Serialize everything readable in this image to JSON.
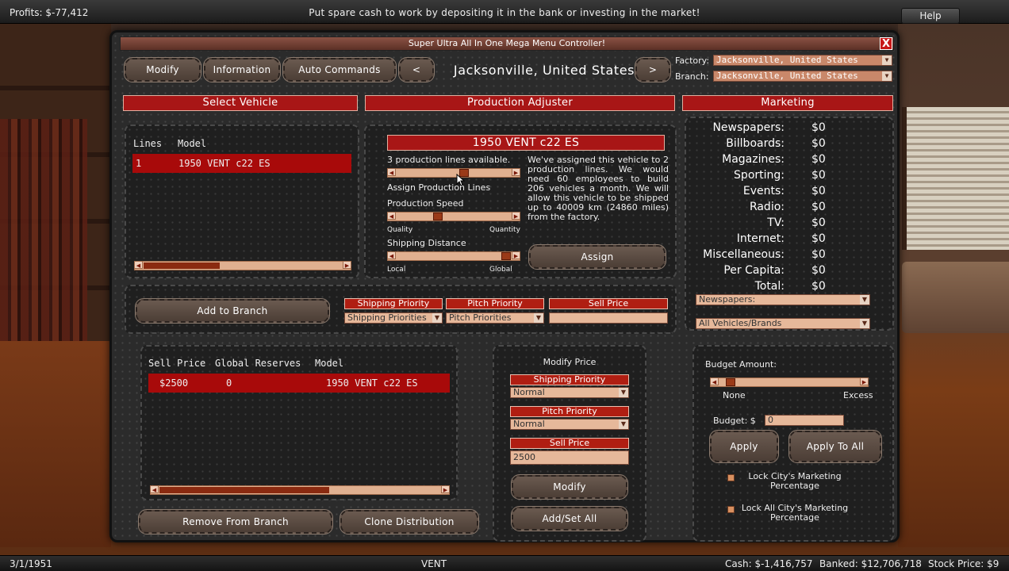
{
  "topbar": {
    "profits": "Profits: $-77,412",
    "tip": "Put spare cash to work by depositing it in the bank or investing in the market!",
    "help": "Help"
  },
  "bottombar": {
    "date": "3/1/1951",
    "company": "VENT",
    "cash": "Cash: $-1,416,757",
    "banked": "Banked: $12,706,718",
    "stock": "Stock Price: $9"
  },
  "window": {
    "title": "Super Ultra All In One Mega Menu Controller!",
    "close": "X"
  },
  "toolbar": {
    "modify": "Modify",
    "information": "Information",
    "auto_commands": "Auto Commands",
    "prev": "<",
    "next": ">",
    "city": "Jacksonville, United States",
    "factory_label": "Factory:",
    "factory_value": "Jacksonville, United States",
    "branch_label": "Branch:",
    "branch_value": "Jacksonville, United States"
  },
  "sections": {
    "select_vehicle": "Select Vehicle",
    "production_adjuster": "Production Adjuster",
    "marketing": "Marketing"
  },
  "vehicle_list": {
    "headers": [
      "Lines",
      "Model"
    ],
    "rows": [
      {
        "lines": "1",
        "model": "1950 VENT c22 ES"
      }
    ]
  },
  "production": {
    "vehicle": "1950 VENT c22 ES",
    "lines_available": "3  production lines available.",
    "assign_lines": "Assign Production Lines",
    "speed": "Production Speed",
    "quality": "Quality",
    "quantity": "Quantity",
    "shipping_distance": "Shipping Distance",
    "local": "Local",
    "global": "Global",
    "note": "We've assigned this vehicle to 2 production lines. We would need 60 employees to build 206 vehicles a month. We will allow this vehicle to be shipped up to 40009 km (24860 miles) from the factory.",
    "assign": "Assign",
    "lines_level": 0.6,
    "speed_level": 0.35,
    "distance_level": 1.0
  },
  "branch_controls": {
    "add_to_branch": "Add to Branch",
    "shipping_priority": "Shipping Priority",
    "pitch_priority": "Pitch Priority",
    "sell_price": "Sell Price",
    "shipping_priorities": "Shipping Priorities",
    "pitch_priorities": "Pitch Priorities"
  },
  "branch_list": {
    "headers": [
      "Sell Price",
      "Global Reserves",
      "Model"
    ],
    "rows": [
      {
        "sell_price": "$2500",
        "reserves": "0",
        "model": "1950  VENT c22 ES"
      }
    ],
    "remove": "Remove From Branch",
    "clone": "Clone Distribution"
  },
  "modify_price": {
    "title": "Modify Price",
    "shipping_priority": "Shipping Priority",
    "shipping_value": "Normal",
    "pitch_priority": "Pitch Priority",
    "pitch_value": "Normal",
    "sell_price": "Sell Price",
    "sell_value": "2500",
    "modify": "Modify",
    "add_set_all": "Add/Set All"
  },
  "marketing": {
    "rows": [
      {
        "k": "Newspapers:",
        "v": "$0"
      },
      {
        "k": "Billboards:",
        "v": "$0"
      },
      {
        "k": "Magazines:",
        "v": "$0"
      },
      {
        "k": "Sporting:",
        "v": "$0"
      },
      {
        "k": "Events:",
        "v": "$0"
      },
      {
        "k": "Radio:",
        "v": "$0"
      },
      {
        "k": "TV:",
        "v": "$0"
      },
      {
        "k": "Internet:",
        "v": "$0"
      },
      {
        "k": "Miscellaneous:",
        "v": "$0"
      },
      {
        "k": "Per Capita:",
        "v": "$0"
      },
      {
        "k": "Total:",
        "v": "$0"
      }
    ],
    "media_select": "Newspapers:",
    "brand_select": "All Vehicles/Brands",
    "budget_amount": "Budget Amount:",
    "none": "None",
    "excess": "Excess",
    "budget_label": "Budget: $",
    "budget_value": "0",
    "apply": "Apply",
    "apply_to_all": "Apply To All",
    "lock_city": "Lock City's Marketing Percentage",
    "lock_all": "Lock All City's Marketing Percentage",
    "budget_level": 0.05
  },
  "colors": {
    "accent_red": "#a80a0a",
    "slider_bg": "#e0b090"
  }
}
